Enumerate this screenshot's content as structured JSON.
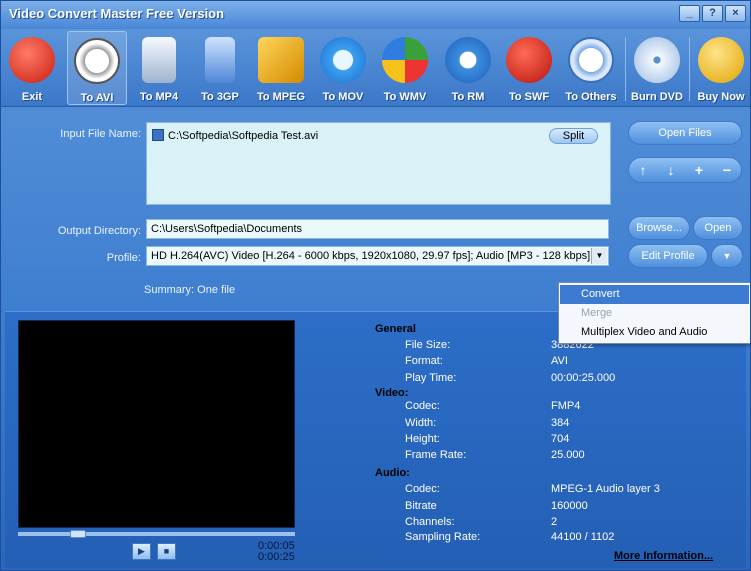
{
  "window": {
    "title": "Video Convert Master Free Version",
    "controls": [
      "_",
      "?",
      "×"
    ]
  },
  "toolbar": {
    "items": [
      {
        "label": "Exit",
        "icon": "power-icon",
        "color": "#e13a2a"
      },
      {
        "label": "To AVI",
        "icon": "film-reel-icon",
        "color": "#f2f2f2"
      },
      {
        "label": "To MP4",
        "icon": "mp4-player-icon",
        "color": "#c7d6ea"
      },
      {
        "label": "To 3GP",
        "icon": "phone-icon",
        "color": "#8ab8ff"
      },
      {
        "label": "To MPEG",
        "icon": "mpeg-film-icon",
        "color": "#f2b51c"
      },
      {
        "label": "To MOV",
        "icon": "quicktime-icon",
        "color": "#5ab0f5"
      },
      {
        "label": "To WMV",
        "icon": "wmv-play-icon",
        "color": "#f3f3f3"
      },
      {
        "label": "To RM",
        "icon": "realmedia-icon",
        "color": "#3b8fe0"
      },
      {
        "label": "To SWF",
        "icon": "flash-icon",
        "color": "#d92b20"
      },
      {
        "label": "To Others",
        "icon": "film-reel-blue-icon",
        "color": "#b5d3ff"
      },
      {
        "label": "Burn DVD",
        "icon": "disc-icon",
        "color": "#d5e6f7"
      },
      {
        "label": "Buy Now",
        "icon": "cart-icon",
        "color": "#f5c21b"
      }
    ]
  },
  "form": {
    "input_label": "Input File Name:",
    "input_file": "C:\\Softpedia\\Softpedia Test.avi",
    "split_label": "Split",
    "output_label": "Output Directory:",
    "output_value": "C:\\Users\\Softpedia\\Documents",
    "profile_label": "Profile:",
    "profile_value": "HD  H.264(AVC) Video [H.264 - 6000 kbps, 1920x1080, 29.97 fps]; Audio [MP3 - 128 kbps]",
    "summary": "Summary: One file"
  },
  "buttons": {
    "open_files": "Open Files",
    "browse": "Browse...",
    "open": "Open",
    "edit_profile": "Edit Profile",
    "arrows": [
      "↑",
      "↓",
      "+",
      "−"
    ]
  },
  "context_menu": {
    "items": [
      {
        "label": "Convert",
        "state": "selected"
      },
      {
        "label": "Merge",
        "state": "disabled"
      },
      {
        "label": "Multiplex Video and Audio",
        "state": "normal"
      }
    ]
  },
  "player": {
    "time_current": "0:00:05",
    "time_total": "0:00:25",
    "play_label": "▶",
    "stop_label": "■"
  },
  "info": {
    "general_header": "General",
    "general": [
      {
        "key": "File Size:",
        "value": "3882622"
      },
      {
        "key": "Format:",
        "value": "AVI"
      },
      {
        "key": "Play Time:",
        "value": "00:00:25.000"
      }
    ],
    "video_header": "Video:",
    "video": [
      {
        "key": "Codec:",
        "value": "FMP4"
      },
      {
        "key": "Width:",
        "value": "384"
      },
      {
        "key": "Height:",
        "value": "704"
      },
      {
        "key": "Frame Rate:",
        "value": "25.000"
      }
    ],
    "audio_header": "Audio:",
    "audio": [
      {
        "key": "Codec:",
        "value": "MPEG-1 Audio layer 3"
      },
      {
        "key": "Bitrate",
        "value": "160000"
      },
      {
        "key": "Channels:",
        "value": "2"
      },
      {
        "key": "Sampling Rate:",
        "value": "44100 / 1102"
      }
    ],
    "more_label": "More Information..."
  }
}
